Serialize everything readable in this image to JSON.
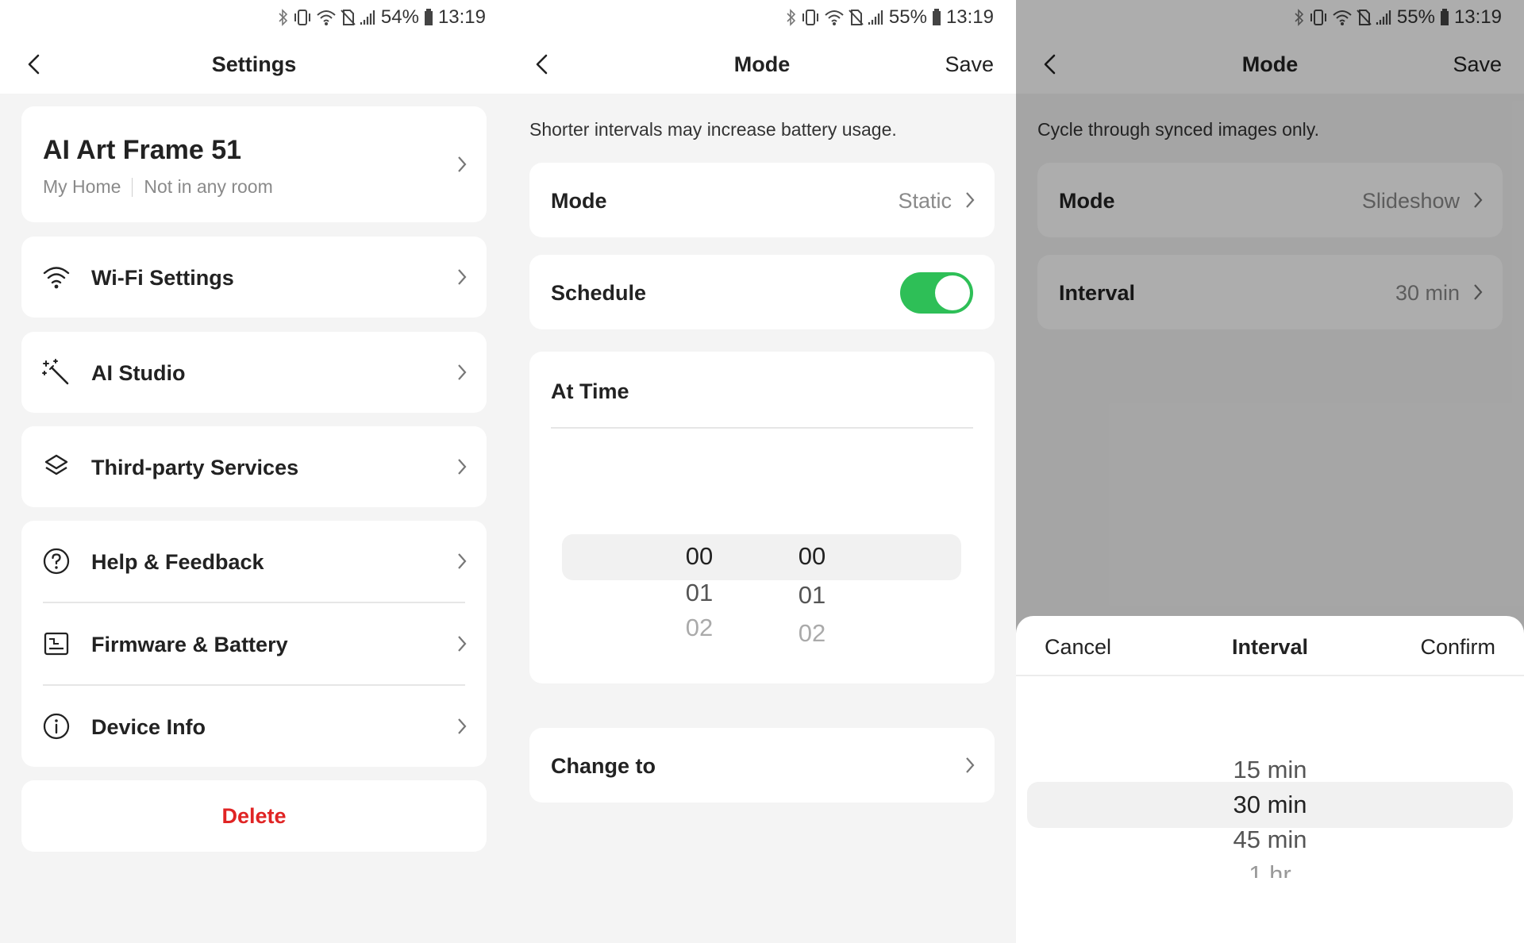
{
  "left": {
    "status": {
      "battery": "54%",
      "time": "13:19"
    },
    "nav": {
      "title": "Settings"
    },
    "device": {
      "name": "AI Art Frame 51",
      "home": "My Home",
      "room": "Not in any room"
    },
    "menu": [
      {
        "label": "Wi-Fi Settings",
        "icon": "wifi-icon"
      },
      {
        "label": "AI Studio",
        "icon": "magic-wand-icon"
      },
      {
        "label": "Third-party Services",
        "icon": "layers-icon"
      },
      {
        "label": "Help & Feedback",
        "icon": "help-circle-icon"
      },
      {
        "label": "Firmware & Battery",
        "icon": "firmware-icon"
      },
      {
        "label": "Device Info",
        "icon": "info-icon"
      }
    ],
    "delete_label": "Delete"
  },
  "middle": {
    "status": {
      "battery": "55%",
      "time": "13:19"
    },
    "nav": {
      "title": "Mode",
      "save": "Save"
    },
    "hint": "Shorter intervals may increase battery usage.",
    "mode": {
      "label": "Mode",
      "value": "Static"
    },
    "schedule": {
      "label": "Schedule",
      "enabled": true
    },
    "at_time": {
      "label": "At Time",
      "hours": [
        "00",
        "01",
        "02"
      ],
      "minutes": [
        "00",
        "01",
        "02"
      ],
      "selected_hour": "00",
      "selected_minute": "00"
    },
    "change_to": {
      "label": "Change to"
    }
  },
  "right": {
    "status": {
      "battery": "55%",
      "time": "13:19"
    },
    "nav": {
      "title": "Mode",
      "save": "Save"
    },
    "hint": "Cycle through synced images only.",
    "mode": {
      "label": "Mode",
      "value": "Slideshow"
    },
    "interval": {
      "label": "Interval",
      "value": "30 min"
    },
    "sheet": {
      "cancel": "Cancel",
      "title": "Interval",
      "confirm": "Confirm",
      "options": [
        "15 min",
        "30 min",
        "45 min",
        "1 hr"
      ],
      "selected": "30 min"
    }
  },
  "colors": {
    "accent_green": "#2ebf57",
    "danger_red": "#e02424",
    "muted_text": "#8a8a8a"
  }
}
